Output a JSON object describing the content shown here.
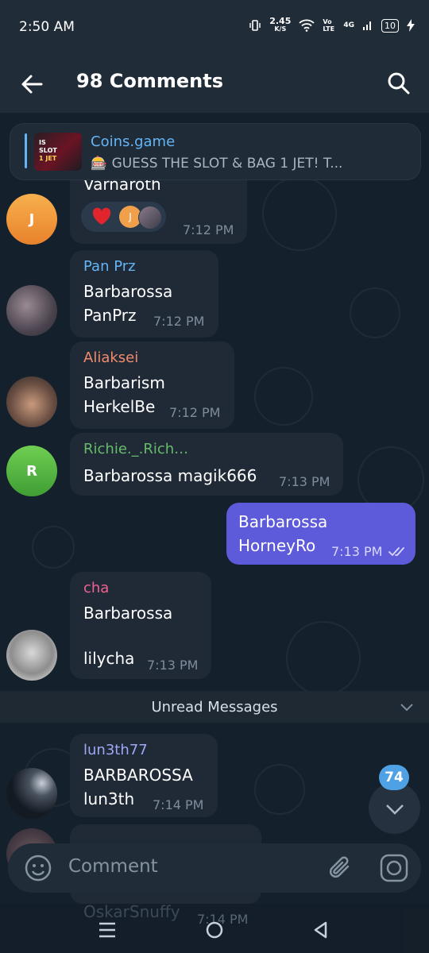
{
  "status": {
    "time": "2:50 AM",
    "net_speed": "2.45",
    "net_unit": "K/S",
    "volte": "Vo LTE",
    "signal": "4G",
    "battery": "10"
  },
  "header": {
    "title": "98 Comments"
  },
  "pinned": {
    "thumb_text1": "IS",
    "thumb_text2": "SLOT",
    "thumb_text3": "1 JET",
    "title": "Coins.game",
    "text": "🎰 GUESS THE SLOT & BAG 1 JET! T..."
  },
  "messages": {
    "m1": {
      "avatar_letter": "J",
      "partial_text": "Varnaroth",
      "reaction_avatar_letter": "J",
      "time": "7:12 PM"
    },
    "m2": {
      "name": "Pan Prz",
      "line1": "Barbarossa",
      "line2": "PanPrz",
      "time": "7:12 PM"
    },
    "m3": {
      "name": "Aliaksei",
      "line1": "Barbarism",
      "line2": "HerkelBe",
      "time": "7:12 PM"
    },
    "m4": {
      "avatar_letter": "R",
      "name": "Richie._.Rich…",
      "line1": "Barbarossa magik666",
      "time": "7:13 PM"
    },
    "m5": {
      "line1": "Barbarossa",
      "line2": "HorneyRo",
      "time": "7:13 PM"
    },
    "m6": {
      "name": "cha",
      "line1": "Barbarossa",
      "line2": "lilycha",
      "time": "7:13 PM"
    },
    "m7": {
      "name": "lun3th77",
      "line1": "BARBAROSSA",
      "line2": "lun3th",
      "time": "7:14 PM"
    },
    "m8": {
      "name": "OskarSnuffy",
      "line1": "OskarSnuffy",
      "time": "7:14 PM"
    }
  },
  "unread": {
    "label": "Unread Messages"
  },
  "scroll_badge": {
    "count": "74"
  },
  "composer": {
    "placeholder": "Comment"
  },
  "colors": {
    "pan_prz": "#64b5f6",
    "aliaksei": "#f28b6b",
    "richie": "#66bb6a",
    "cha": "#f06292",
    "lun3th77": "#9fa8f5",
    "own_bubble": "#5d5bd9"
  }
}
